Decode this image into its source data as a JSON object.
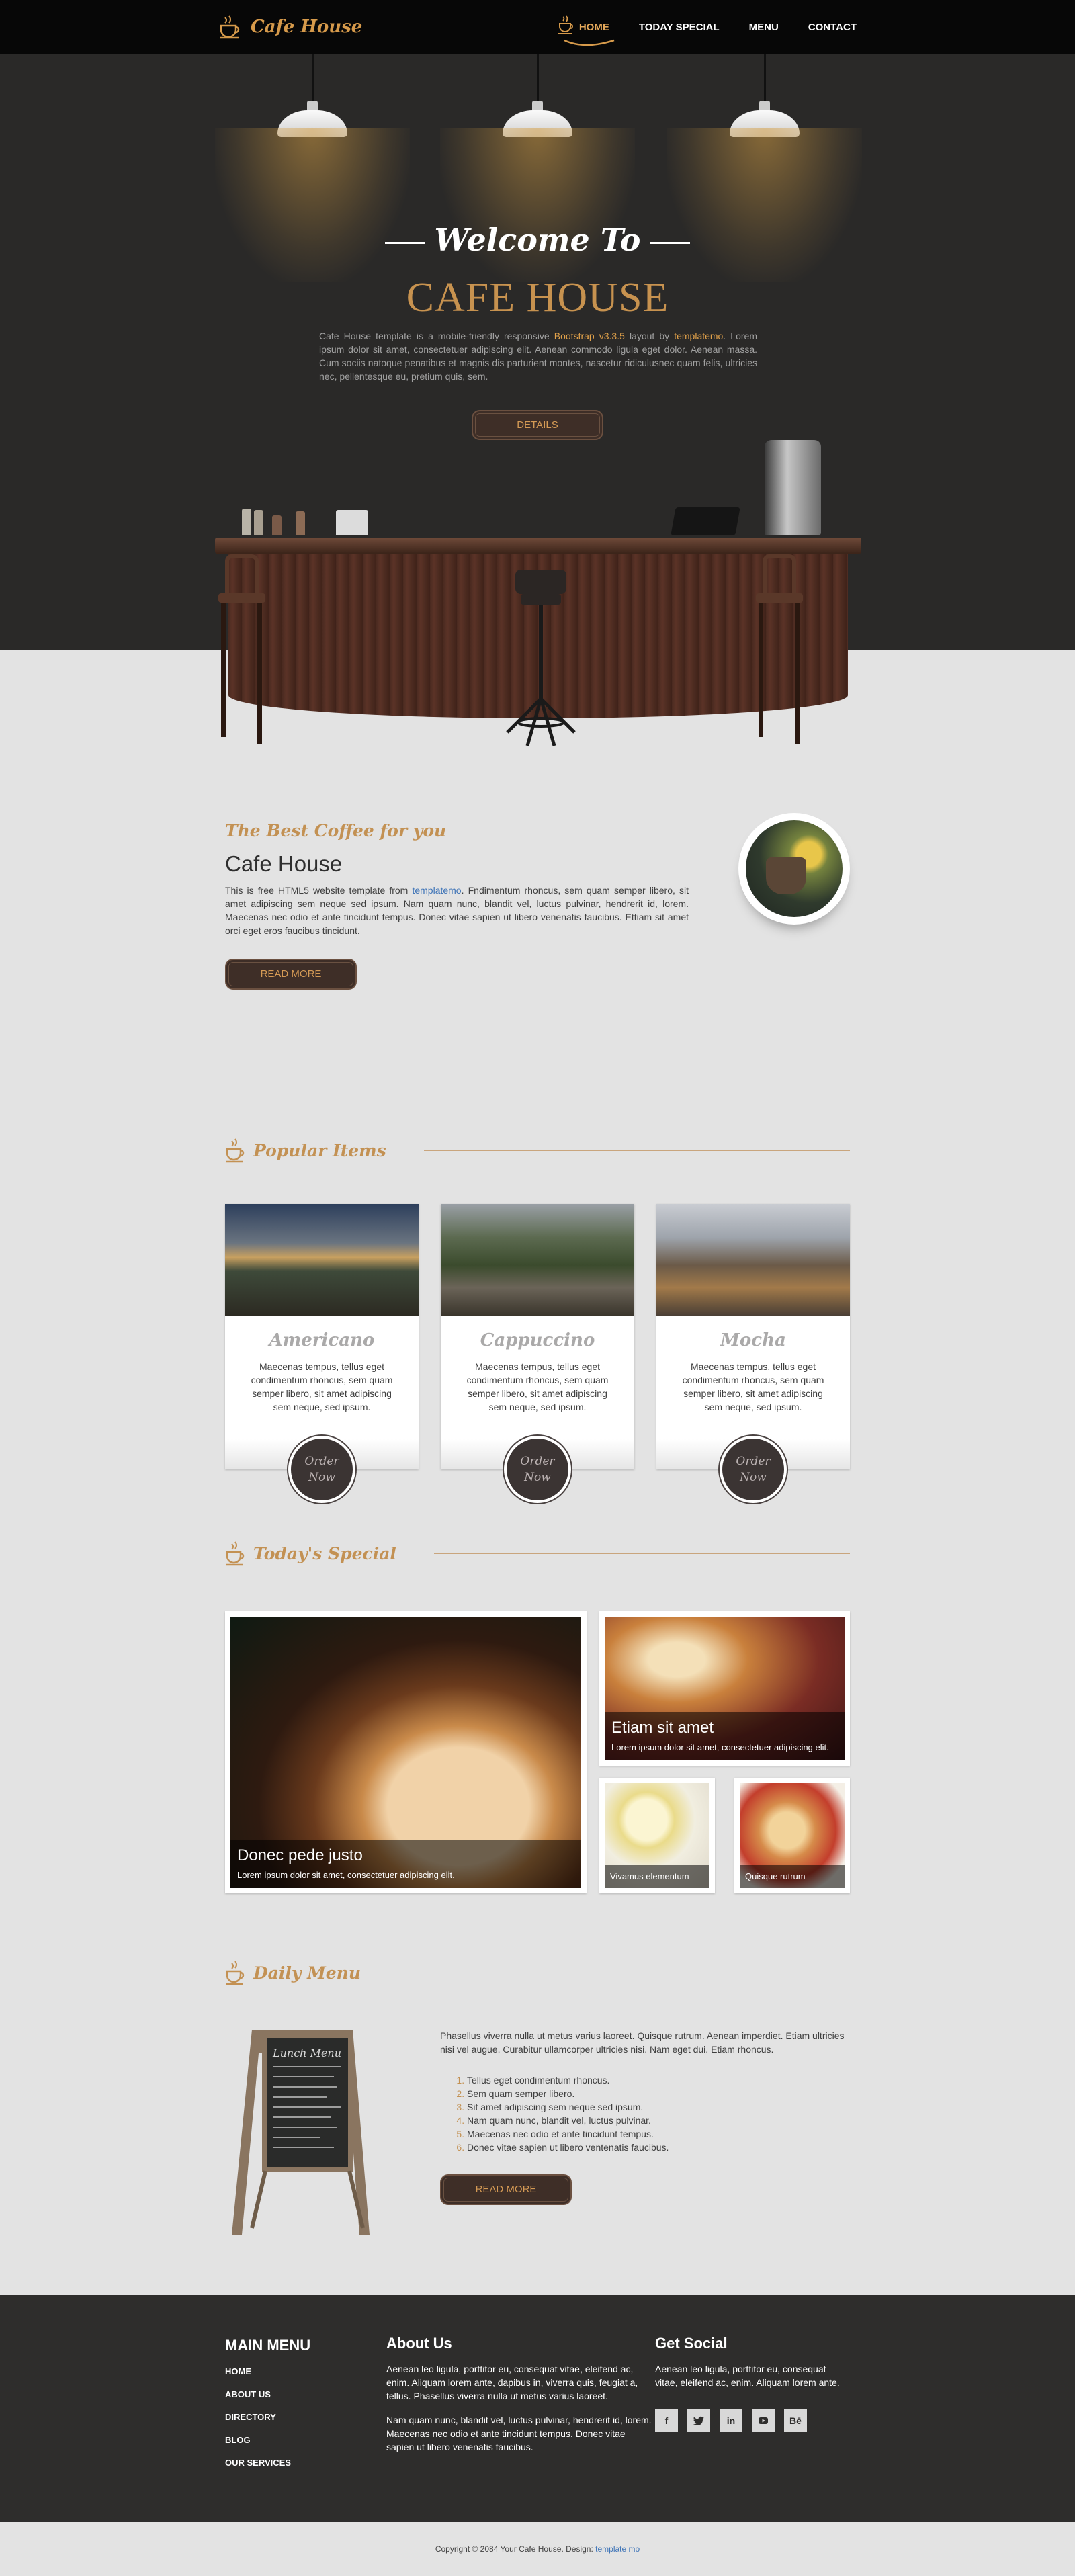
{
  "nav": {
    "logo": "Cafe House",
    "items": [
      {
        "label": "HOME",
        "active": true
      },
      {
        "label": "TODAY SPECIAL",
        "active": false
      },
      {
        "label": "MENU",
        "active": false
      },
      {
        "label": "CONTACT",
        "active": false
      }
    ]
  },
  "hero": {
    "welcome": "Welcome To",
    "brand": "CAFE HOUSE",
    "text_a": "Cafe House template is a mobile-friendly responsive ",
    "text_link1": "Bootstrap v3.3.5",
    "text_b": " layout by ",
    "text_link2": "templatemo",
    "text_c": ". Lorem ipsum dolor sit amet, consectetuer adipiscing elit. Aenean commodo ligula eget dolor. Aenean massa. Cum sociis natoque penatibus et magnis dis parturient montes, nascetur ridiculusnec quam felis, ultricies nec, pellentesque eu, pretium quis, sem.",
    "button": "DETAILS"
  },
  "about": {
    "script": "The Best Coffee for you",
    "title": "Cafe House",
    "text_a": "This is free HTML5 website template from ",
    "text_link": "templatemo",
    "text_b": ". Fndimentum rhoncus, sem quam semper libero, sit amet adipiscing sem neque sed ipsum. Nam quam nunc, blandit vel, luctus pulvinar, hendrerit id, lorem. Maecenas nec odio et ante tincidunt tempus. Donec vitae sapien ut libero venenatis faucibus. Ettiam sit amet orci eget eros faucibus tincidunt.",
    "button": "READ MORE"
  },
  "popular": {
    "heading": "Popular Items",
    "items": [
      {
        "name": "Americano",
        "desc": "Maecenas tempus, tellus eget condimentum rhoncus, sem quam semper libero, sit amet adipiscing sem neque, sed ipsum.",
        "order": "Order Now"
      },
      {
        "name": "Cappuccino",
        "desc": "Maecenas tempus, tellus eget condimentum rhoncus, sem quam semper libero, sit amet adipiscing sem neque, sed ipsum.",
        "order": "Order Now"
      },
      {
        "name": "Mocha",
        "desc": "Maecenas tempus, tellus eget condimentum rhoncus, sem quam semper libero, sit amet adipiscing sem neque, sed ipsum.",
        "order": "Order Now"
      }
    ]
  },
  "special": {
    "heading": "Today's Special",
    "big": {
      "title": "Donec pede justo",
      "text": "Lorem ipsum dolor sit amet, consectetuer adipiscing elit."
    },
    "top_right": {
      "title": "Etiam sit amet",
      "text": "Lorem ipsum dolor sit amet, consectetuer adipiscing elit."
    },
    "small1": {
      "text": "Vivamus elementum"
    },
    "small2": {
      "text": "Quisque rutrum"
    }
  },
  "daily": {
    "heading": "Daily Menu",
    "board_title": "Lunch Menu",
    "text": "Phasellus viverra nulla ut metus varius laoreet. Quisque rutrum. Aenean imperdiet. Etiam ultricies nisi vel augue. Curabitur ullamcorper ultricies nisi. Nam eget dui. Etiam rhoncus.",
    "list": [
      "Tellus eget condimentum rhoncus.",
      "Sem quam semper libero.",
      "Sit amet adipiscing sem neque sed ipsum.",
      "Nam quam nunc, blandit vel, luctus pulvinar.",
      "Maecenas nec odio et ante tincidunt tempus.",
      "Donec vitae sapien ut libero ventenatis faucibus."
    ],
    "button": "READ MORE"
  },
  "footer": {
    "main_menu_title": "MAIN MENU",
    "main_menu": [
      "HOME",
      "ABOUT US",
      "DIRECTORY",
      "BLOG",
      "OUR SERVICES"
    ],
    "about_title": "About Us",
    "about_p1": "Aenean leo ligula, porttitor eu, consequat vitae, eleifend ac, enim. Aliquam lorem ante, dapibus in, viverra quis, feugiat a, tellus. Phasellus viverra nulla ut metus varius laoreet.",
    "about_p2": "Nam quam nunc, blandit vel, luctus pulvinar, hendrerit id, lorem. Maecenas nec odio et ante tincidunt tempus. Donec vitae sapien ut libero venenatis faucibus.",
    "social_title": "Get Social",
    "social_text": "Aenean leo ligula, porttitor eu, consequat vitae, eleifend ac, enim. Aliquam lorem ante.",
    "social_icons": [
      "f",
      "t",
      "in",
      "yt",
      "Bē"
    ],
    "copyright": "Copyright © 2084 Your Cafe House. Design: ",
    "copyright_link": "template mo"
  },
  "colors": {
    "accent": "#c39153",
    "nav_bg": "#070707",
    "hero_bg": "#2a2928",
    "footer_bg": "#2e2d2c",
    "page_bg": "#e3e3e3"
  }
}
